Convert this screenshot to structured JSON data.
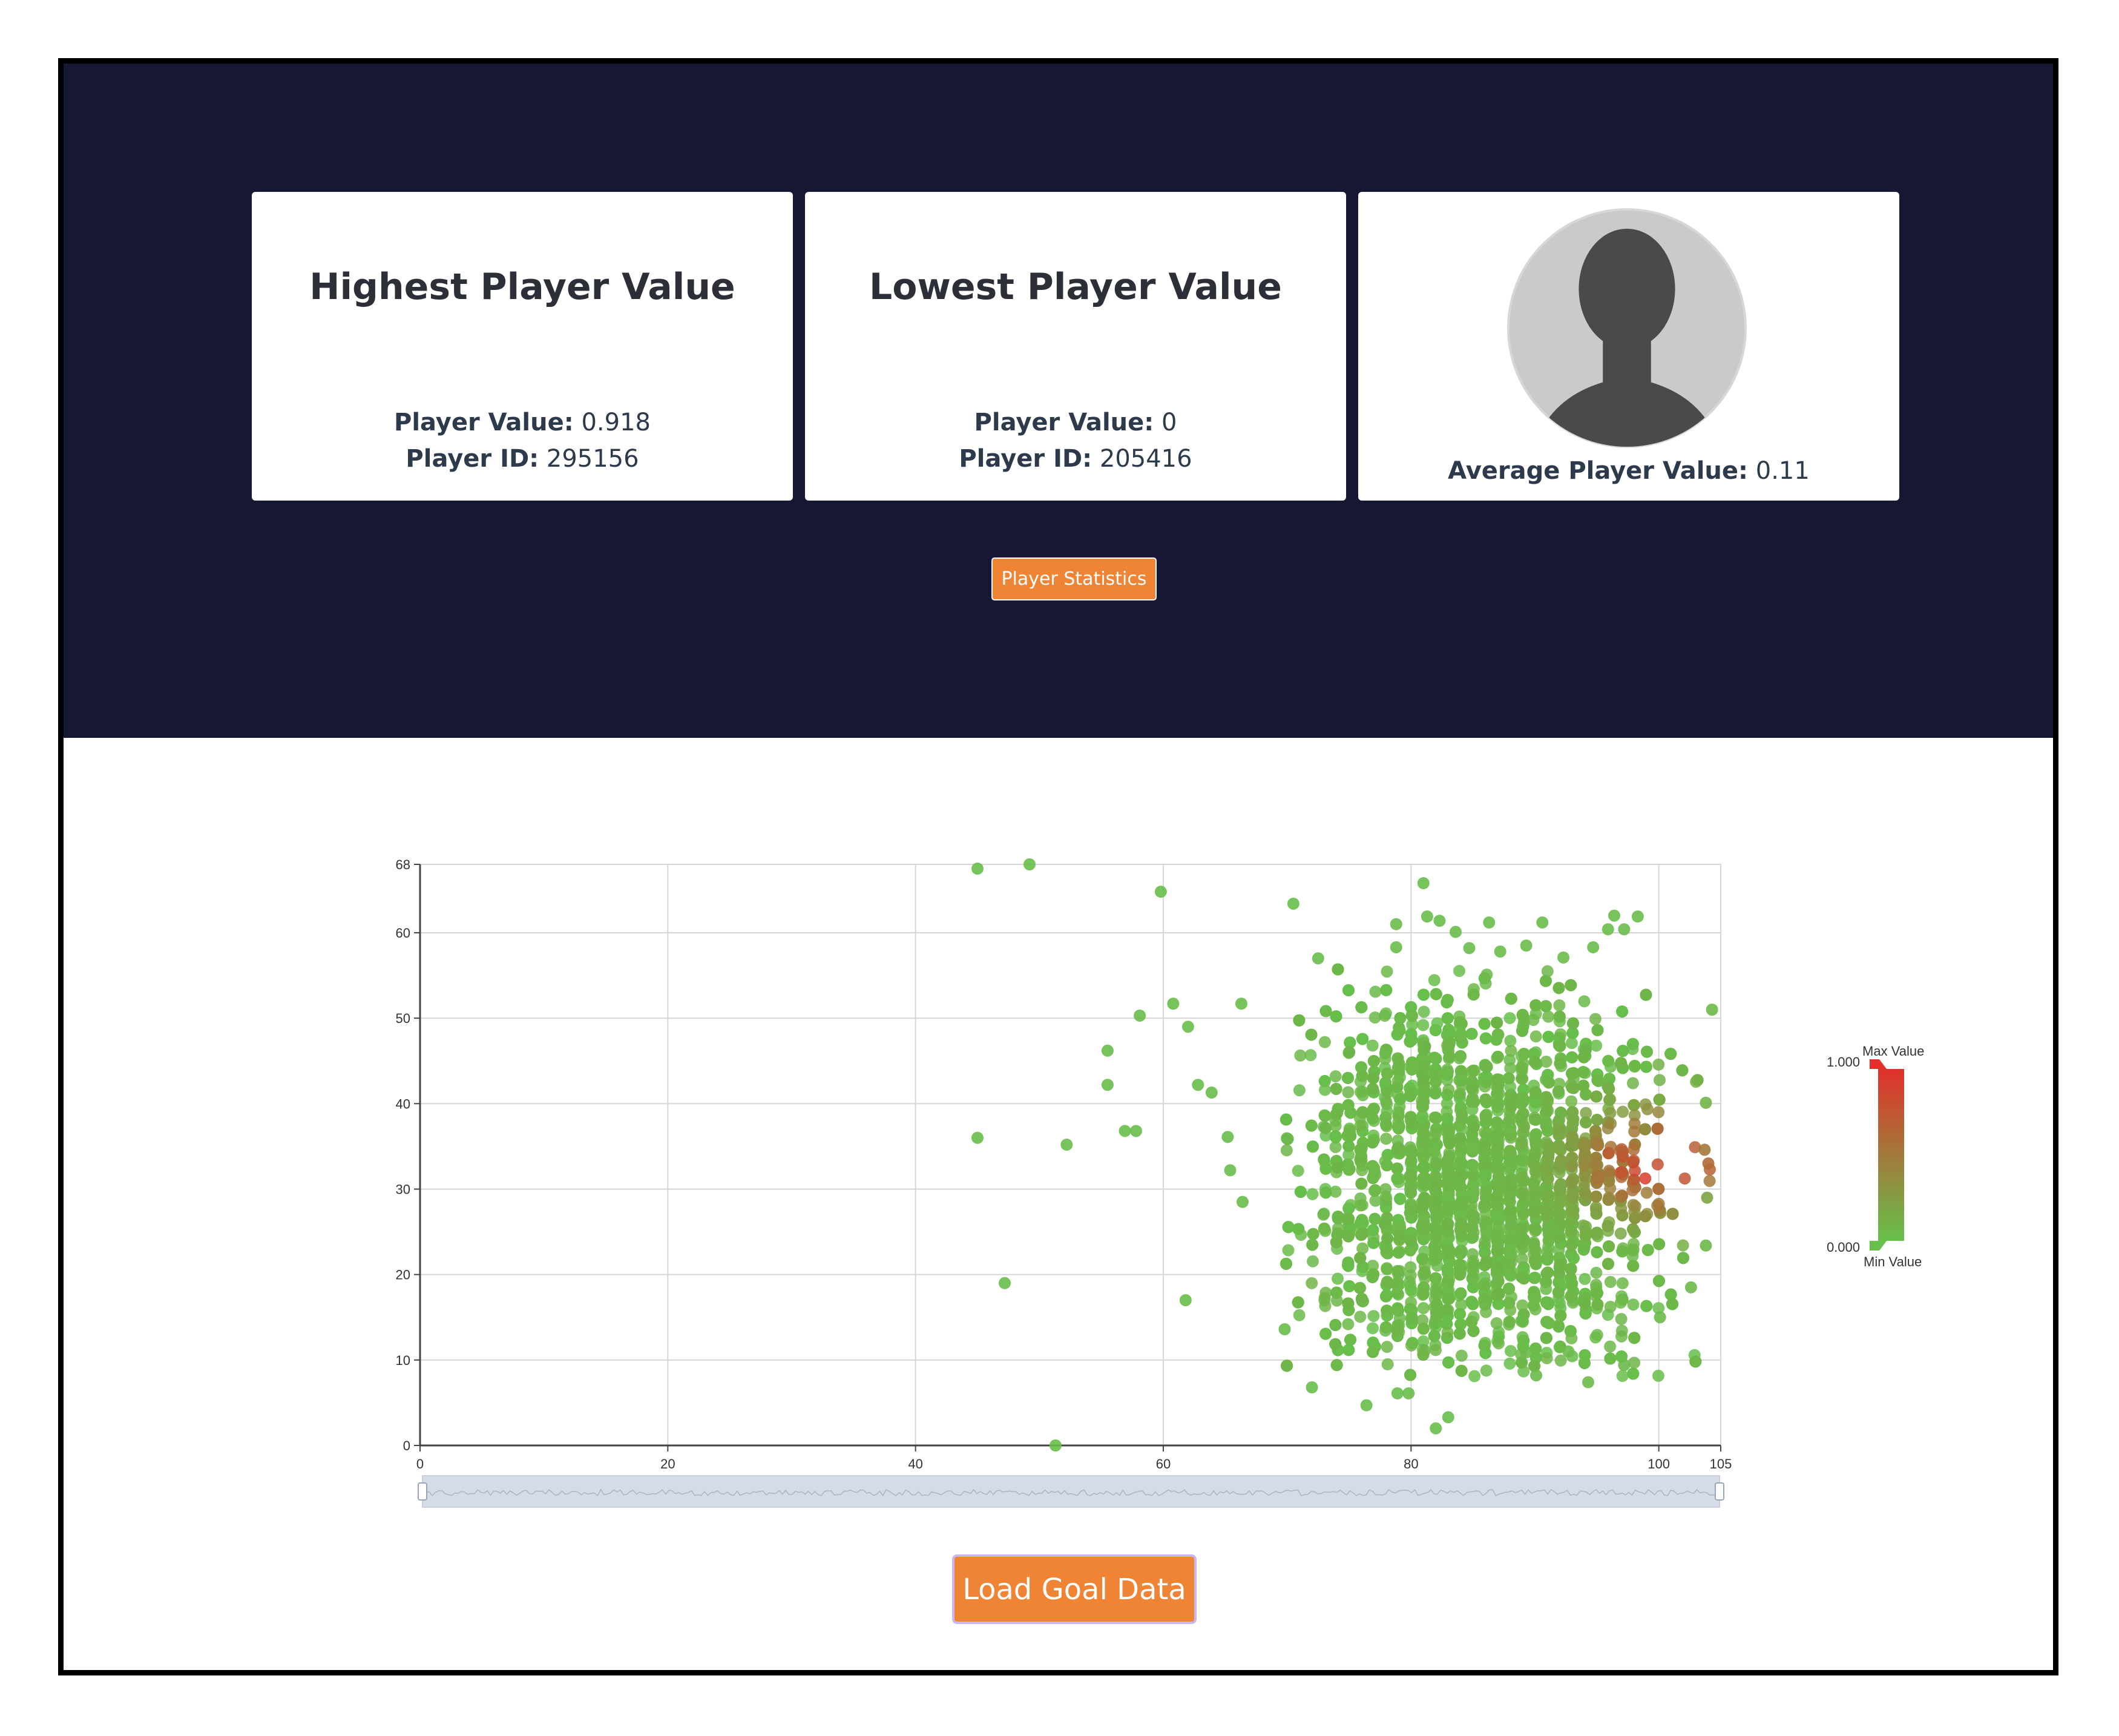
{
  "cards": {
    "highest": {
      "title": "Highest Player Value",
      "value_label": "Player Value:",
      "value": "0.918",
      "id_label": "Player ID:",
      "id": "295156"
    },
    "lowest": {
      "title": "Lowest Player Value",
      "value_label": "Player Value:",
      "value": "0",
      "id_label": "Player ID:",
      "id": "205416"
    },
    "average": {
      "label": "Average Player Value:",
      "value": "0.11"
    }
  },
  "buttons": {
    "player_statistics": "Player Statistics",
    "load_goal_data": "Load Goal Data"
  },
  "colors": {
    "header_bg": "#161833",
    "accent": "#ef8434",
    "min_color": "#66c04b",
    "max_color": "#e0312a"
  },
  "chart_data": {
    "type": "scatter",
    "title": "",
    "xlabel": "",
    "ylabel": "",
    "xlim": [
      0,
      105
    ],
    "ylim": [
      0,
      68
    ],
    "x_ticks": [
      "0",
      "20",
      "40",
      "60",
      "80",
      "100",
      "105"
    ],
    "y_ticks": [
      "0",
      "10",
      "20",
      "30",
      "40",
      "50",
      "60",
      "68"
    ],
    "grid": true,
    "color_scale": {
      "max_label": "Max Value",
      "min_label": "Min Value",
      "max_value": "1.000",
      "min_value": "0.000"
    },
    "points": [
      [
        45,
        67.5,
        0.02
      ],
      [
        49.2,
        68,
        0.02
      ],
      [
        59.8,
        64.8,
        0.02
      ],
      [
        70.5,
        63.4,
        0.02
      ],
      [
        81,
        65.8,
        0.02
      ],
      [
        81.3,
        61.9,
        0.02
      ],
      [
        82.3,
        61.4,
        0.02
      ],
      [
        86.3,
        61.2,
        0.02
      ],
      [
        90.6,
        61.2,
        0.03
      ],
      [
        95.9,
        60.4,
        0.03
      ],
      [
        97.2,
        60.4,
        0.03
      ],
      [
        98.3,
        61.9,
        0.03
      ],
      [
        72.5,
        57,
        0.02
      ],
      [
        58.1,
        50.3,
        0.02
      ],
      [
        60.8,
        51.7,
        0.02
      ],
      [
        66.3,
        51.7,
        0.02
      ],
      [
        62,
        49,
        0.02
      ],
      [
        55.5,
        46.2,
        0.02
      ],
      [
        55.5,
        42.2,
        0.02
      ],
      [
        62.8,
        42.2,
        0.02
      ],
      [
        63.9,
        41.3,
        0.02
      ],
      [
        45,
        36,
        0.02
      ],
      [
        52.2,
        35.2,
        0.02
      ],
      [
        56.9,
        36.8,
        0.02
      ],
      [
        57.8,
        36.8,
        0.02
      ],
      [
        65.2,
        36.1,
        0.02
      ],
      [
        65.4,
        32.2,
        0.02
      ],
      [
        66.4,
        28.5,
        0.02
      ],
      [
        47.2,
        19,
        0.02
      ],
      [
        61.8,
        17,
        0.02
      ],
      [
        69.8,
        13.6,
        0.02
      ],
      [
        72,
        6.8,
        0.02
      ],
      [
        76.4,
        4.7,
        0.02
      ],
      [
        78.9,
        6.1,
        0.02
      ],
      [
        79.8,
        6.1,
        0.02
      ],
      [
        82,
        2,
        0.02
      ],
      [
        83,
        3.3,
        0.02
      ],
      [
        51.3,
        0,
        0.02
      ],
      [
        104.3,
        51,
        0.05
      ],
      [
        103.8,
        40.1,
        0.1
      ],
      [
        103.8,
        23.4,
        0.06
      ],
      [
        103.9,
        29,
        0.2
      ],
      [
        104,
        33,
        0.6
      ],
      [
        103.7,
        34.6,
        0.5
      ],
      [
        96.4,
        62,
        0.03
      ],
      [
        94.7,
        58.3,
        0.03
      ],
      [
        92.3,
        57.1,
        0.03
      ],
      [
        89.3,
        58.5,
        0.03
      ],
      [
        87.2,
        57.8,
        0.03
      ],
      [
        84.7,
        58.2,
        0.03
      ],
      [
        83.6,
        60.1,
        0.03
      ],
      [
        78.8,
        61,
        0.03
      ],
      [
        78.8,
        58.3,
        0.03
      ],
      [
        92.7,
        11,
        0.04
      ],
      [
        94.3,
        7.4,
        0.04
      ],
      [
        97.2,
        9.4,
        0.04
      ],
      [
        90.1,
        8.2,
        0.04
      ],
      [
        89.3,
        10.9,
        0.04
      ],
      [
        100.1,
        15,
        0.04
      ],
      [
        102.6,
        18.5,
        0.04
      ]
    ],
    "cloud": {
      "x_range": [
        70,
        104.5
      ],
      "y_range": [
        8,
        56
      ],
      "x_center": 86,
      "y_center": 31,
      "hot_x": 100,
      "hot_y": 33,
      "count": 4200
    }
  }
}
